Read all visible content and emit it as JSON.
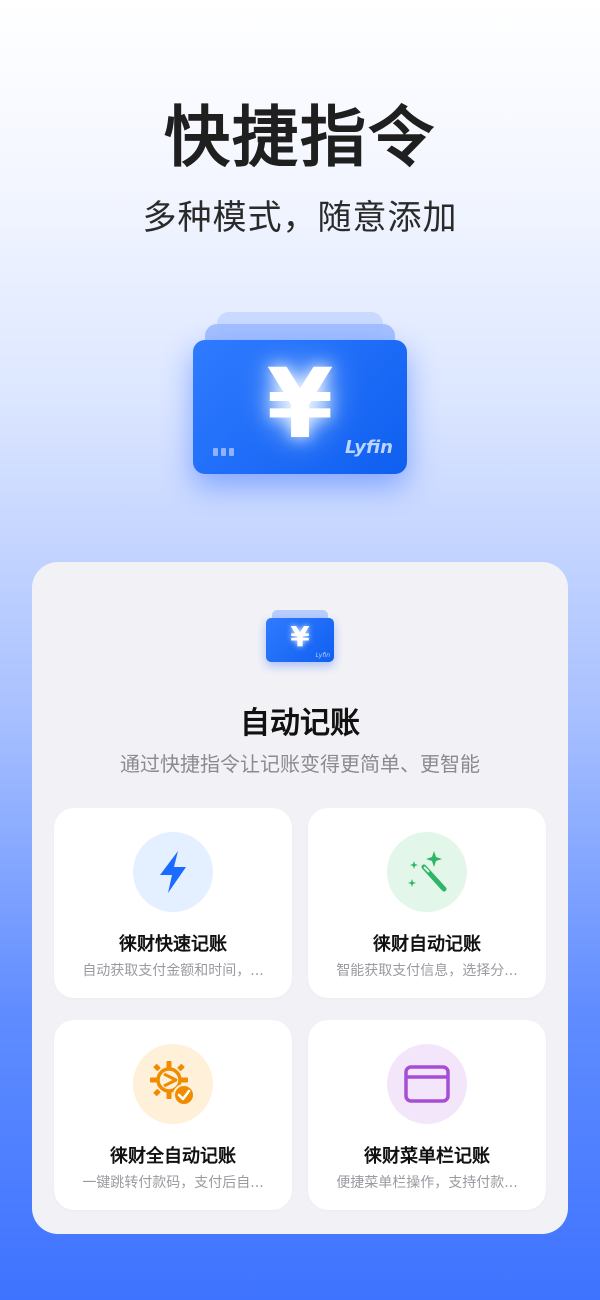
{
  "hero": {
    "title": "快捷指令",
    "subtitle": "多种模式，随意添加"
  },
  "card_icon": {
    "symbol": "¥",
    "brand": "Lyfin",
    "color": "#1a6bff"
  },
  "panel": {
    "title": "自动记账",
    "description": "通过快捷指令让记账变得更简单、更智能",
    "features": [
      {
        "title": "徕财快速记账",
        "description": "自动获取支付金额和时间，...",
        "icon": "lightning-icon",
        "icon_color": "#1a6bff"
      },
      {
        "title": "徕财自动记账",
        "description": "智能获取支付信息，选择分...",
        "icon": "magic-wand-icon",
        "icon_color": "#2fb567"
      },
      {
        "title": "徕财全自动记账",
        "description": "一键跳转付款码，支付后自...",
        "icon": "gear-check-icon",
        "icon_color": "#f08c00"
      },
      {
        "title": "徕财菜单栏记账",
        "description": "便捷菜单栏操作，支持付款...",
        "icon": "window-icon",
        "icon_color": "#a64fd6"
      }
    ]
  }
}
